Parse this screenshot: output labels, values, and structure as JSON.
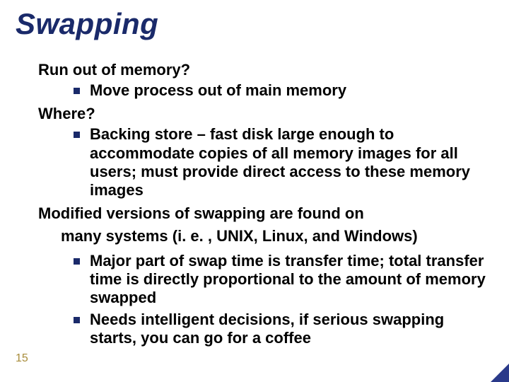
{
  "title": "Swapping",
  "page_number": "15",
  "sections": {
    "q1": "Run out of memory?",
    "q1_b1": "Move process out of main memory",
    "q2": "Where?",
    "q2_b1": "Backing store – fast disk large enough to accommodate copies of all memory images for all users; must provide direct access to these memory images",
    "q3_line1": "Modified versions of swapping are found on",
    "q3_line2": "many systems (i. e. , UNIX, Linux, and Windows)",
    "q3_b1": "Major part of swap time is transfer time; total transfer time is directly proportional to the amount of memory swapped",
    "q3_b2": "Needs intelligent decisions, if serious swapping starts, you can go for a coffee"
  }
}
